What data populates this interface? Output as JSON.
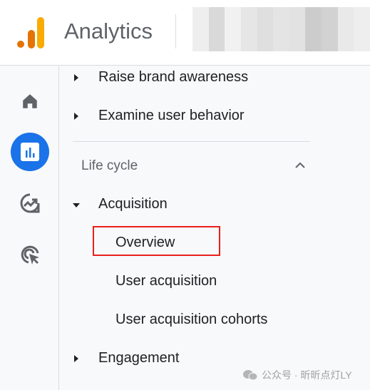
{
  "header": {
    "app_title": "Analytics",
    "logo_icon": "google-analytics-logo",
    "account_name_redacted": true
  },
  "rail": {
    "items": [
      {
        "icon": "home-icon"
      },
      {
        "icon": "reports-icon",
        "active": true
      },
      {
        "icon": "explore-icon"
      },
      {
        "icon": "advertising-icon"
      }
    ],
    "accent": "#1a73e8"
  },
  "nav": {
    "top_items": [
      "Raise brand awareness",
      "Examine user behavior"
    ],
    "section": "Life cycle",
    "acquisition": {
      "label": "Acquisition",
      "children": [
        "Overview",
        "User acquisition",
        "User acquisition cohorts"
      ],
      "highlighted": "Overview"
    },
    "engagement": "Engagement"
  },
  "watermark": "公众号 · 昕昕点灯LY",
  "highlight_color": "#e8201c"
}
